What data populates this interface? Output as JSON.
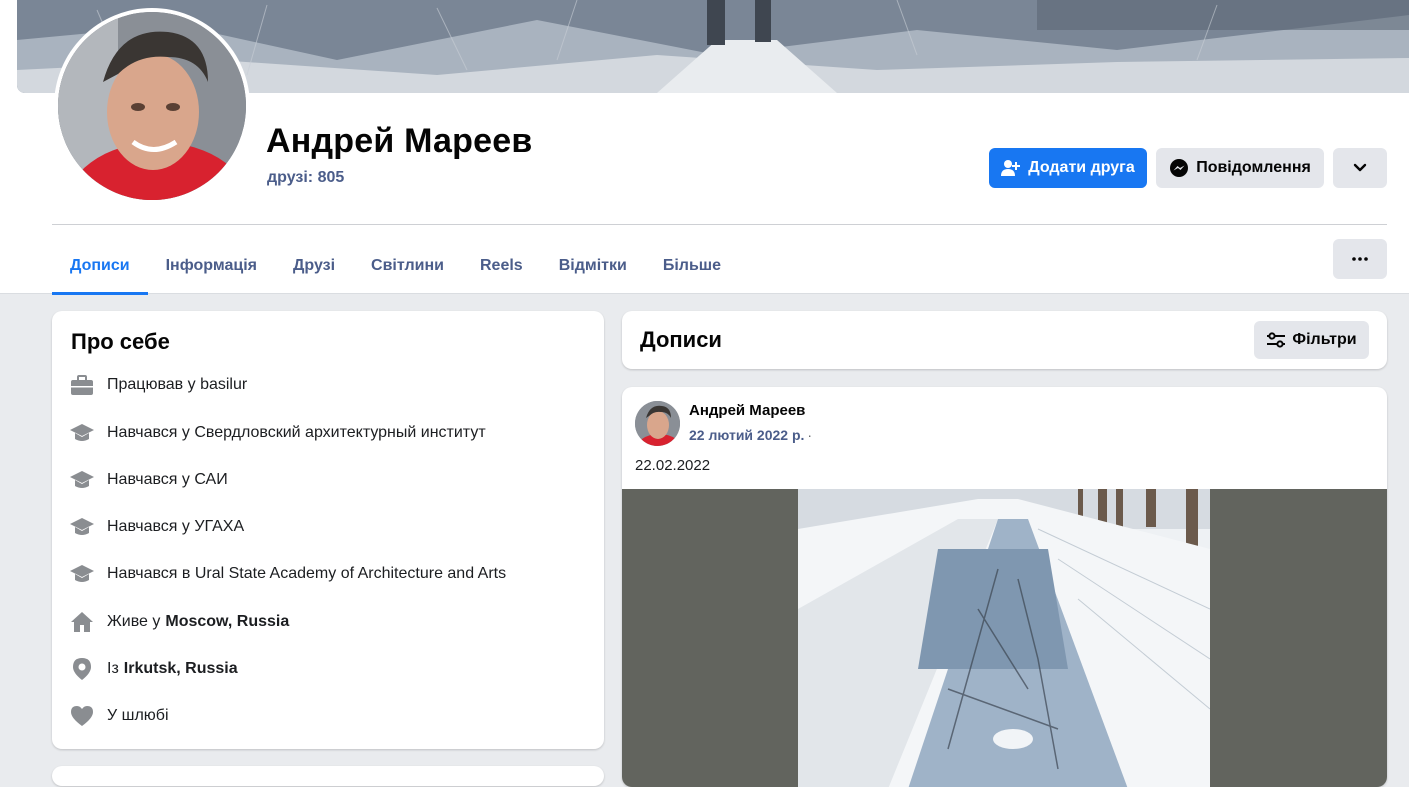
{
  "profile": {
    "name": "Андрей Мареев",
    "friends": "друзі: 805"
  },
  "actions": {
    "add_friend": "Додати друга",
    "message": "Повідомлення"
  },
  "tabs": [
    {
      "label": "Дописи",
      "active": true
    },
    {
      "label": "Інформація",
      "active": false
    },
    {
      "label": "Друзі",
      "active": false
    },
    {
      "label": "Світлини",
      "active": false
    },
    {
      "label": "Reels",
      "active": false
    },
    {
      "label": "Відмітки",
      "active": false
    },
    {
      "label": "Більше",
      "active": false
    }
  ],
  "about": {
    "title": "Про себе",
    "items": [
      {
        "icon": "briefcase-icon",
        "text": "Працював у basilur",
        "bold": ""
      },
      {
        "icon": "graduation-cap-icon",
        "text": "Навчався у Свердловский архитектурный институт",
        "bold": ""
      },
      {
        "icon": "graduation-cap-icon",
        "text": "Навчався у САИ",
        "bold": ""
      },
      {
        "icon": "graduation-cap-icon",
        "text": "Навчався у УГАХА",
        "bold": ""
      },
      {
        "icon": "graduation-cap-icon",
        "text": "Навчався в Ural State Academy of Architecture and Arts",
        "bold": ""
      },
      {
        "icon": "home-icon",
        "text": "Живе у",
        "bold": "Moscow, Russia"
      },
      {
        "icon": "location-pin-icon",
        "text": "Із",
        "bold": "Irkutsk, Russia"
      },
      {
        "icon": "heart-icon",
        "text": "У шлюбі",
        "bold": ""
      }
    ]
  },
  "posts": {
    "title": "Дописи",
    "filter_label": "Фільтри",
    "items": [
      {
        "author": "Андрей Мареев",
        "date": "22 лютий 2022 р.",
        "separator": "·",
        "text": "22.02.2022"
      }
    ]
  },
  "colors": {
    "accent": "#1877f2",
    "link": "#4b5d8a",
    "button_gray": "#e4e6eb",
    "page_bg": "#e9ebee"
  }
}
